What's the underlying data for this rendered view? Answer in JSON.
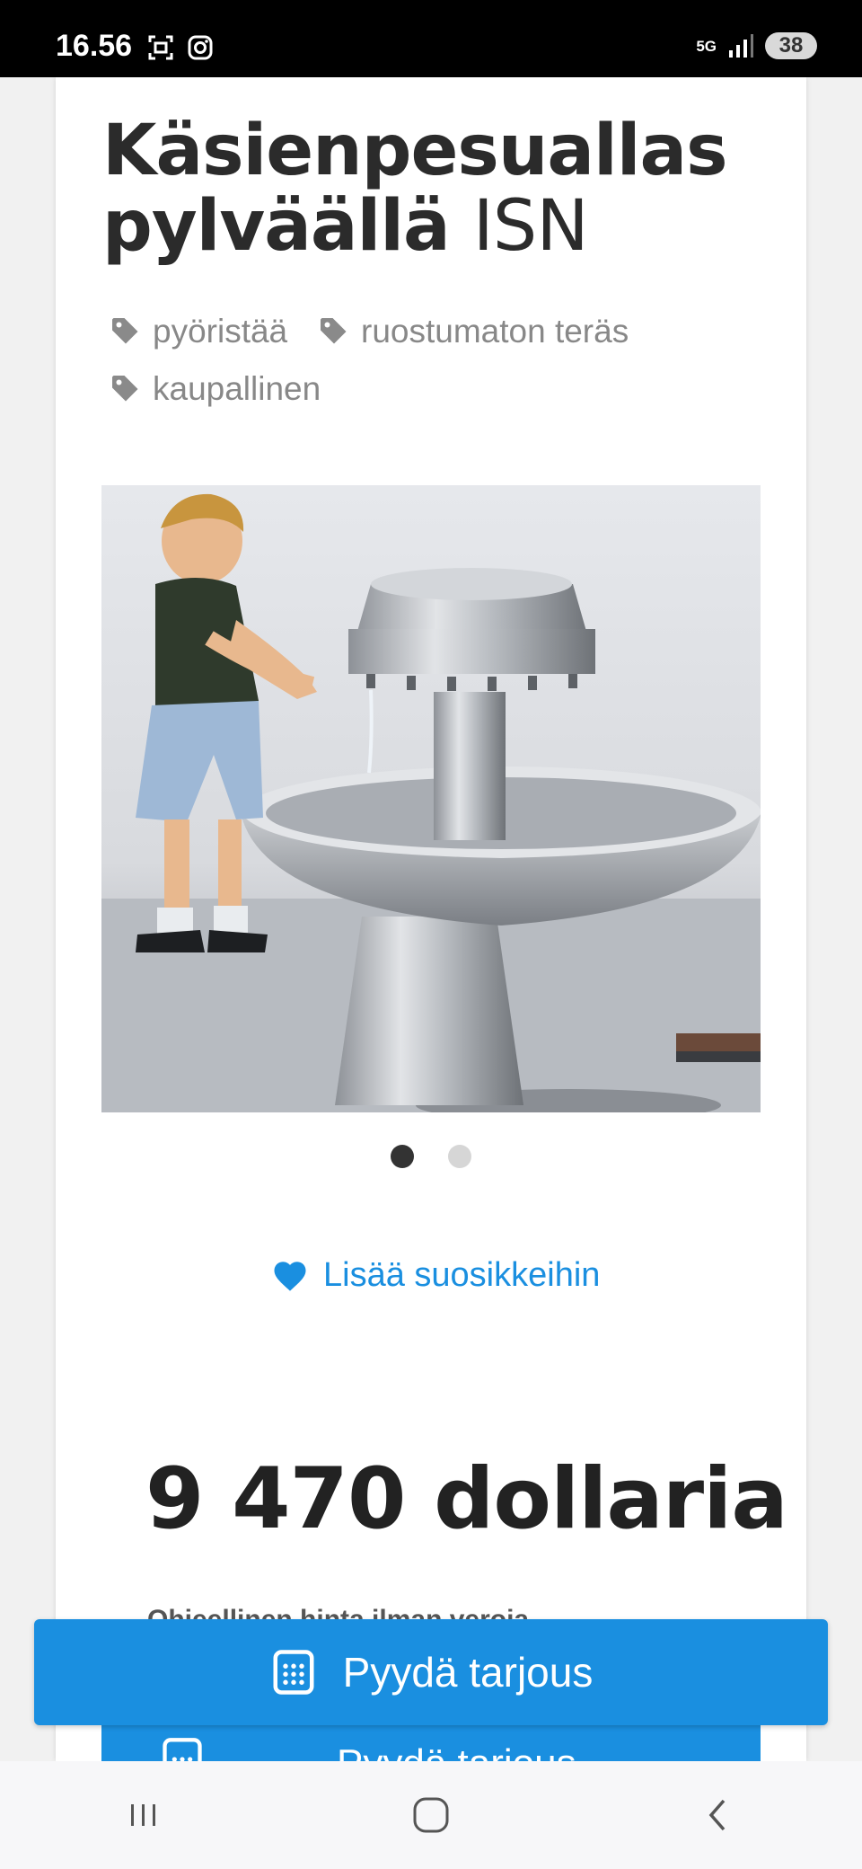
{
  "status_bar": {
    "time": "16.56",
    "network": "5G",
    "battery": "38",
    "icons": [
      "screenshot-icon",
      "instagram-icon",
      "signal-icon"
    ]
  },
  "product": {
    "title": "Käsienpesuallas pylväällä",
    "model": "ISN",
    "tags": [
      "pyöristää",
      "ruostumaton teräs",
      "kaupallinen"
    ],
    "image_dots": {
      "count": 2,
      "active": 1
    },
    "favorite_label": "Lisää suosikkeihin",
    "price": "9 470 dollaria",
    "price_note": "Ohjeellinen hinta ilman veroja",
    "quote_button": "Pyydä tarjous",
    "quote_button_behind": "Pyydä tarjous"
  },
  "colors": {
    "accent": "#1a8fe0",
    "title": "#2b2b2b",
    "tag": "#888888"
  },
  "nav_bar": {
    "icons": [
      "recent-apps-icon",
      "home-icon",
      "back-icon"
    ]
  }
}
